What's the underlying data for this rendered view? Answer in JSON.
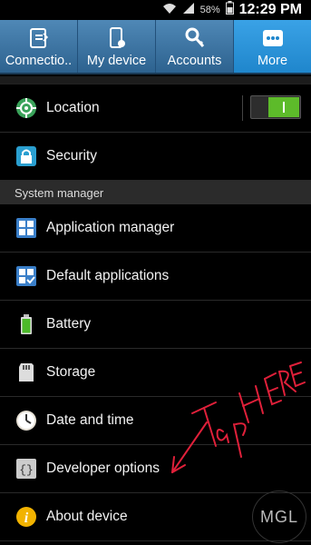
{
  "status": {
    "battery": "58%",
    "time": "12:29 PM"
  },
  "tabs": [
    {
      "label": "Connectio..",
      "icon": "connections-icon",
      "active": false
    },
    {
      "label": "My device",
      "icon": "my-device-icon",
      "active": false
    },
    {
      "label": "Accounts",
      "icon": "accounts-icon",
      "active": false
    },
    {
      "label": "More",
      "icon": "more-icon",
      "active": true
    }
  ],
  "settings": {
    "location": {
      "label": "Location",
      "toggle_on": true
    },
    "security": {
      "label": "Security"
    },
    "system_manager_header": "System manager",
    "application_manager": {
      "label": "Application manager"
    },
    "default_applications": {
      "label": "Default applications"
    },
    "battery": {
      "label": "Battery"
    },
    "storage": {
      "label": "Storage"
    },
    "date_time": {
      "label": "Date and time"
    },
    "developer_options": {
      "label": "Developer options"
    },
    "about_device": {
      "label": "About device"
    }
  },
  "annotation": {
    "text": "Tap HERE",
    "color": "#e0203a"
  },
  "watermark": {
    "text": "MGL"
  },
  "colors": {
    "accent": "#1f86cc",
    "toggle_on": "#5dbb2a"
  }
}
